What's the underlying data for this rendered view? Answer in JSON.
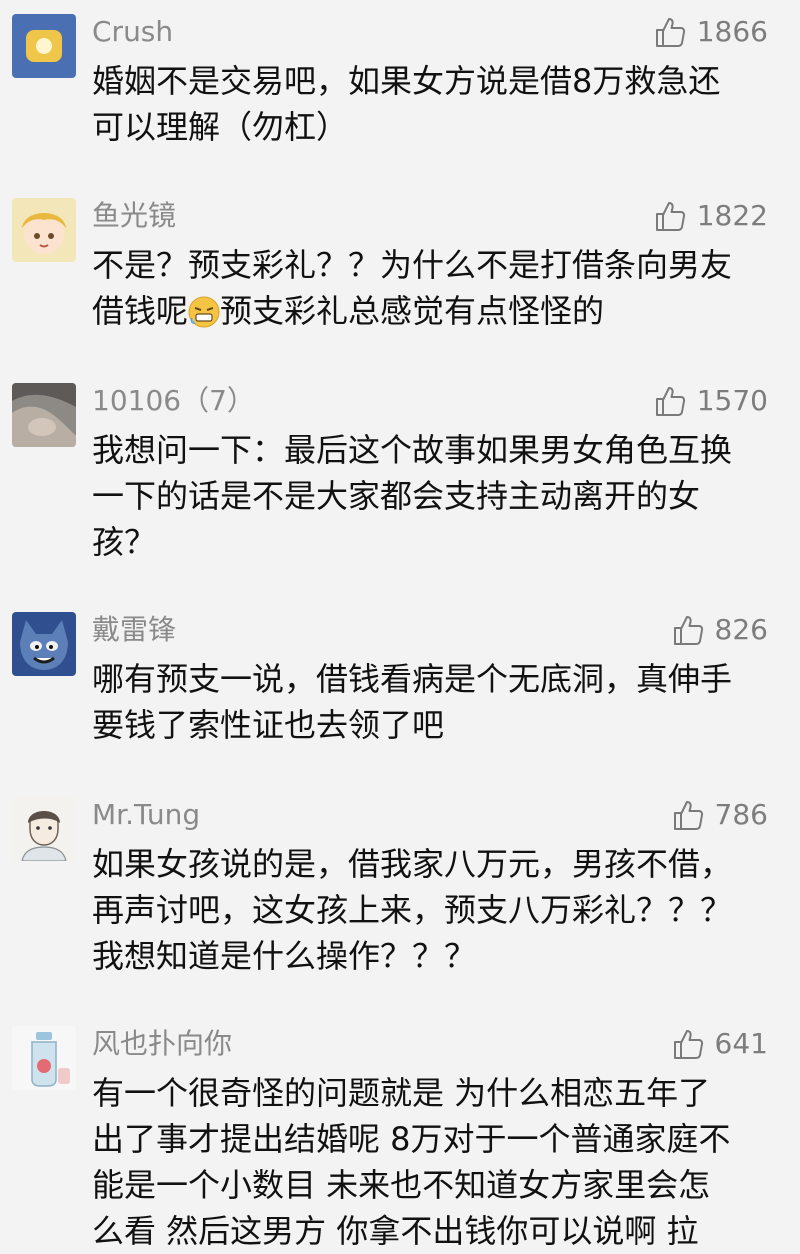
{
  "comments": [
    {
      "username": "Crush",
      "likes": "1866",
      "avatar": "yellow-badge-avatar",
      "lines": [
        "婚姻不是交易吧，如果女方说是借8万救急还",
        "可以理解（勿杠）"
      ]
    },
    {
      "username": "鱼光镜",
      "likes": "1822",
      "avatar": "anime-girl-avatar",
      "lines": [
        "不是？预支彩礼？？为什么不是打借条向男友",
        "借钱呢",
        "预支彩礼总感觉有点怪怪的"
      ],
      "emoji": "grimace-emoji"
    },
    {
      "username": "10106（7）",
      "likes": "1570",
      "avatar": "photo-avatar",
      "lines": [
        "我想问一下：最后这个故事如果男女角色互换",
        "一下的话是不是大家都会支持主动离开的女",
        "孩？"
      ]
    },
    {
      "username": "戴雷锋",
      "likes": "826",
      "avatar": "cartoon-cat-avatar",
      "lines": [
        "哪有预支一说，借钱看病是个无底洞，真伸手",
        "要钱了索性证也去领了吧"
      ]
    },
    {
      "username": "Mr.Tung",
      "likes": "786",
      "avatar": "sketch-boy-avatar",
      "lines": [
        "如果女孩说的是，借我家八万元，男孩不借，",
        "再声讨吧，这女孩上来，预支八万彩礼？？？",
        "我想知道是什么操作？？？"
      ]
    },
    {
      "username": "风也扑向你",
      "likes": "641",
      "avatar": "bottle-avatar",
      "lines": [
        "有一个很奇怪的问题就是 为什么相恋五年了",
        "出了事才提出结婚呢 8万对于一个普通家庭不",
        "能是一个小数目 未来也不知道女方家里会怎",
        "么看 然后这男方 你拿不出钱你可以说啊 拉"
      ]
    }
  ],
  "colors": {
    "background": "#f3f3f3",
    "username": "#8a8a8a",
    "like_count": "#7d7d7d",
    "content": "#111111"
  },
  "icons": {
    "like": "thumbs-up-icon"
  }
}
